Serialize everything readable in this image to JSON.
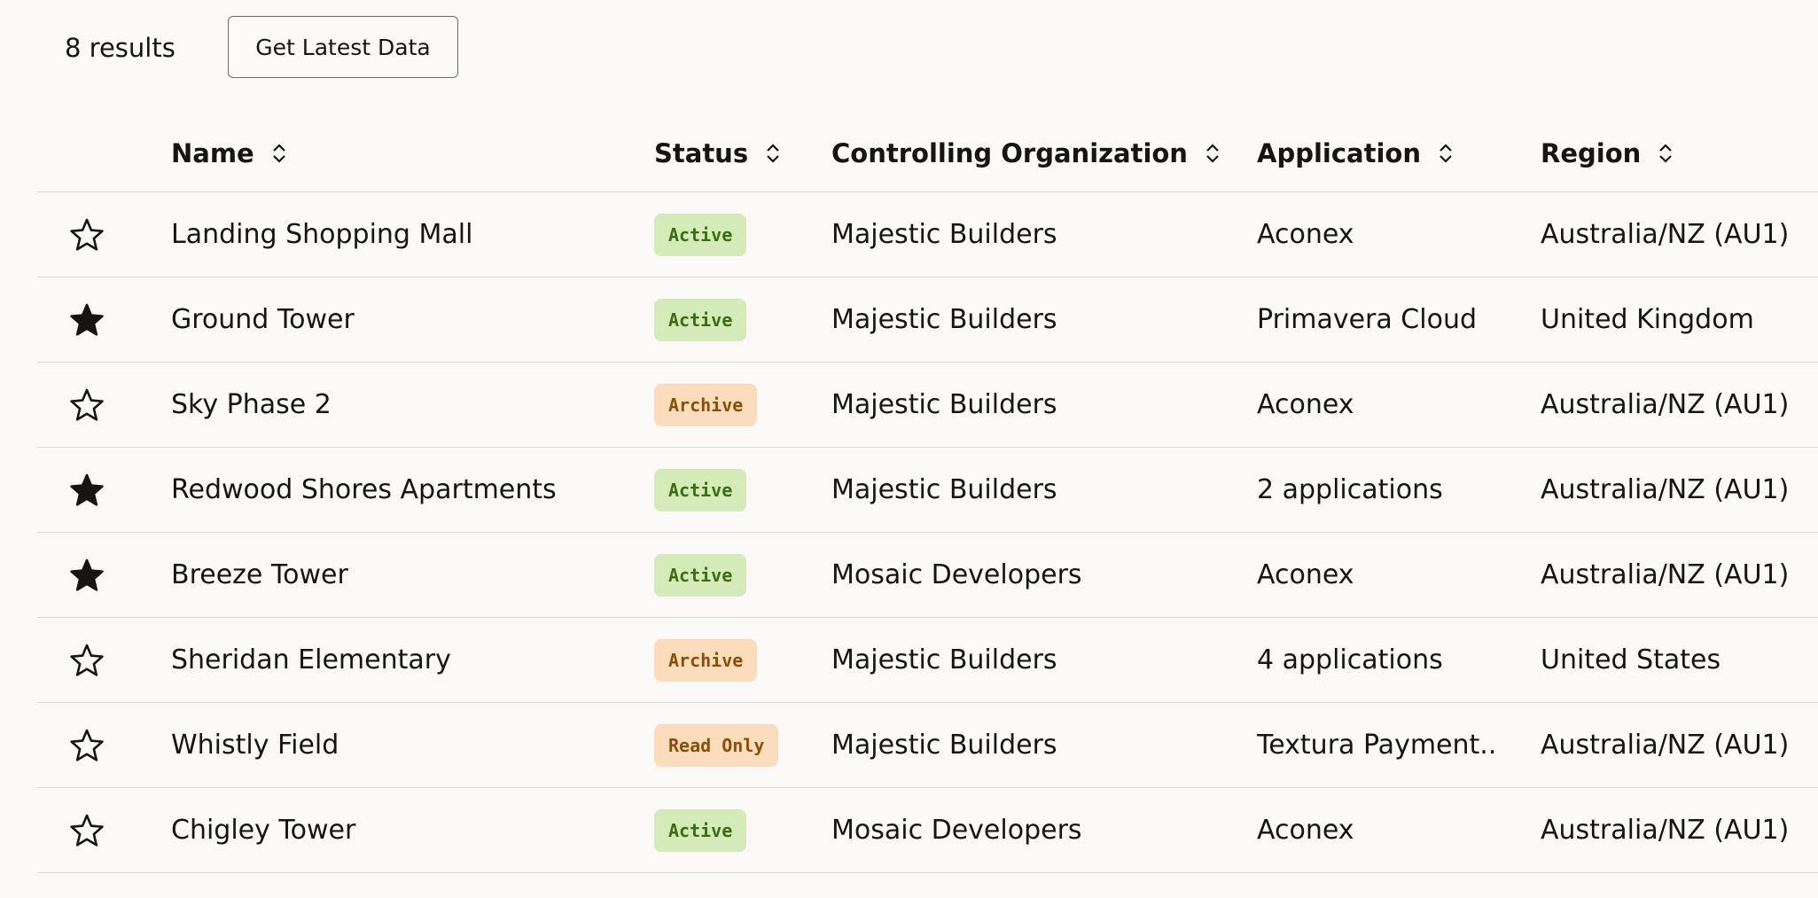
{
  "toolbar": {
    "results_label": "8 results",
    "refresh_label": "Get Latest Data"
  },
  "columns": {
    "name": "Name",
    "status": "Status",
    "org": "Controlling Organization",
    "application": "Application",
    "region": "Region"
  },
  "icons": {
    "favorite": "star-icon",
    "sort": "sort-icon"
  },
  "colors": {
    "active_bg": "#d4eab9",
    "active_text": "#3b6d12",
    "archive_bg": "#fbdcbc",
    "archive_text": "#8a4f07"
  },
  "rows": [
    {
      "favorite": false,
      "name": "Landing Shopping Mall",
      "status": "Active",
      "status_kind": "active",
      "org": "Majestic Builders",
      "application": "Aconex",
      "region": "Australia/NZ (AU1)"
    },
    {
      "favorite": true,
      "name": "Ground Tower",
      "status": "Active",
      "status_kind": "active",
      "org": "Majestic Builders",
      "application": "Primavera Cloud",
      "region": "United Kingdom"
    },
    {
      "favorite": false,
      "name": "Sky Phase 2",
      "status": "Archive",
      "status_kind": "archive",
      "org": "Majestic Builders",
      "application": "Aconex",
      "region": "Australia/NZ (AU1)"
    },
    {
      "favorite": true,
      "name": "Redwood Shores Apartments",
      "status": "Active",
      "status_kind": "active",
      "org": "Majestic Builders",
      "application": "2 applications",
      "region": "Australia/NZ (AU1)"
    },
    {
      "favorite": true,
      "name": "Breeze Tower",
      "status": "Active",
      "status_kind": "active",
      "org": "Mosaic Developers",
      "application": "Aconex",
      "region": "Australia/NZ (AU1)"
    },
    {
      "favorite": false,
      "name": "Sheridan Elementary",
      "status": "Archive",
      "status_kind": "archive",
      "org": "Majestic Builders",
      "application": "4 applications",
      "region": "United States"
    },
    {
      "favorite": false,
      "name": "Whistly Field",
      "status": "Read Only",
      "status_kind": "readonly",
      "org": "Majestic Builders",
      "application": "Textura Payment..",
      "region": "Australia/NZ (AU1)"
    },
    {
      "favorite": false,
      "name": "Chigley Tower",
      "status": "Active",
      "status_kind": "active",
      "org": "Mosaic Developers",
      "application": "Aconex",
      "region": "Australia/NZ (AU1)"
    }
  ]
}
